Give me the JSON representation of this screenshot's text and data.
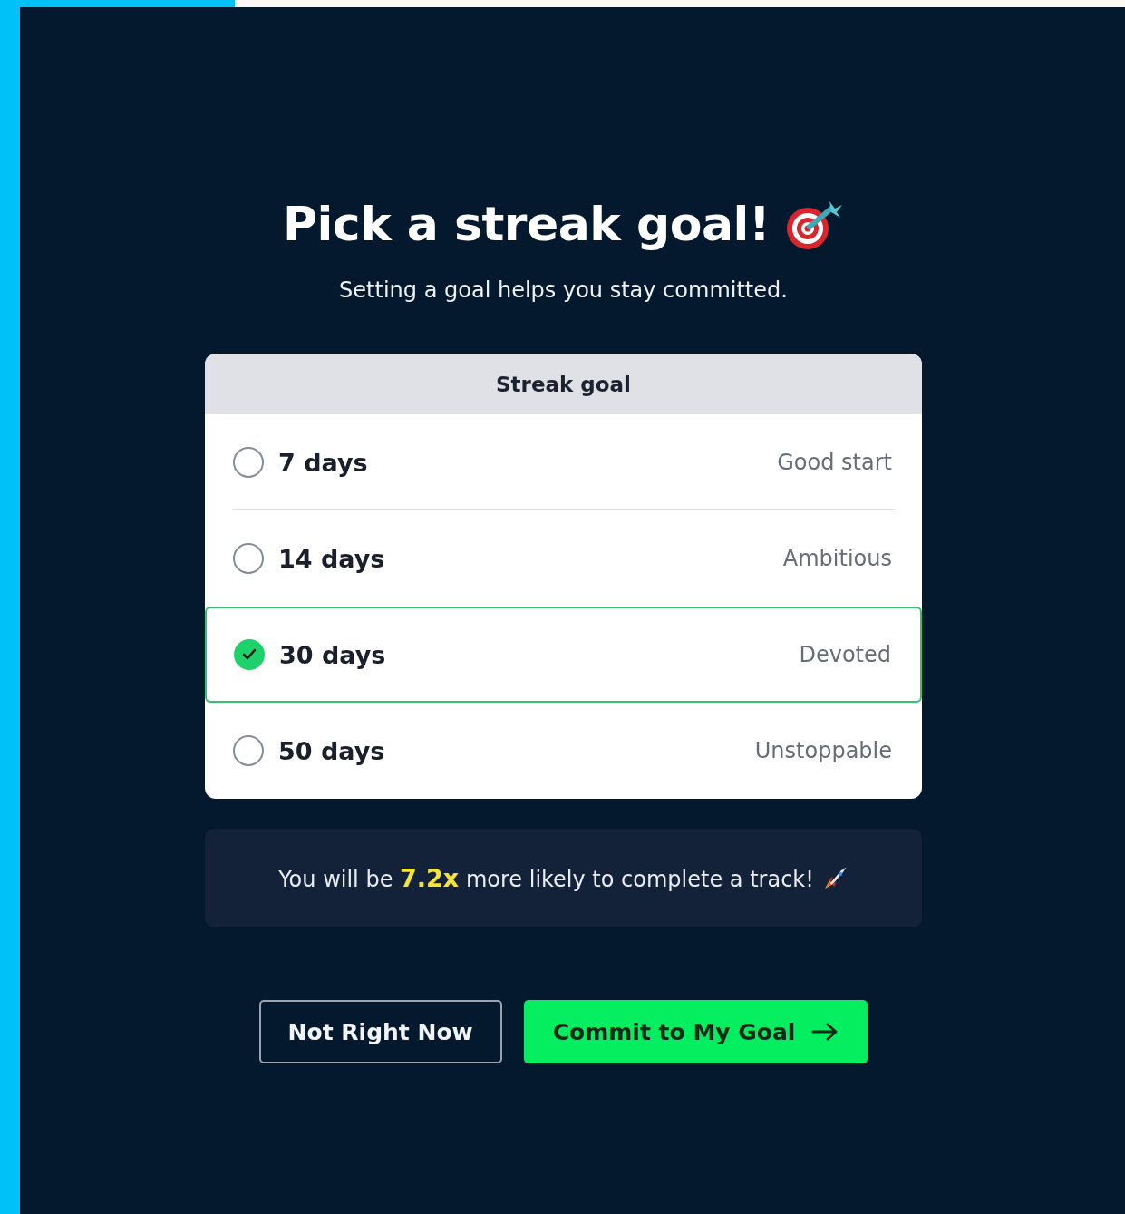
{
  "title": "Pick a streak goal!",
  "subtitle": "Setting a goal helps you stay committed.",
  "goal_card": {
    "header": "Streak goal",
    "options": [
      {
        "label": "7 days",
        "tag": "Good start",
        "selected": false
      },
      {
        "label": "14 days",
        "tag": "Ambitious",
        "selected": false
      },
      {
        "label": "30 days",
        "tag": "Devoted",
        "selected": true
      },
      {
        "label": "50 days",
        "tag": "Unstoppable",
        "selected": false
      }
    ]
  },
  "info": "You will be **7.2x** more likely to complete a track!",
  "buttons": [
    {
      "label": "Not Right Now",
      "kind": "secondary"
    },
    {
      "label": "Commit to My Goal",
      "kind": "primary"
    }
  ]
}
